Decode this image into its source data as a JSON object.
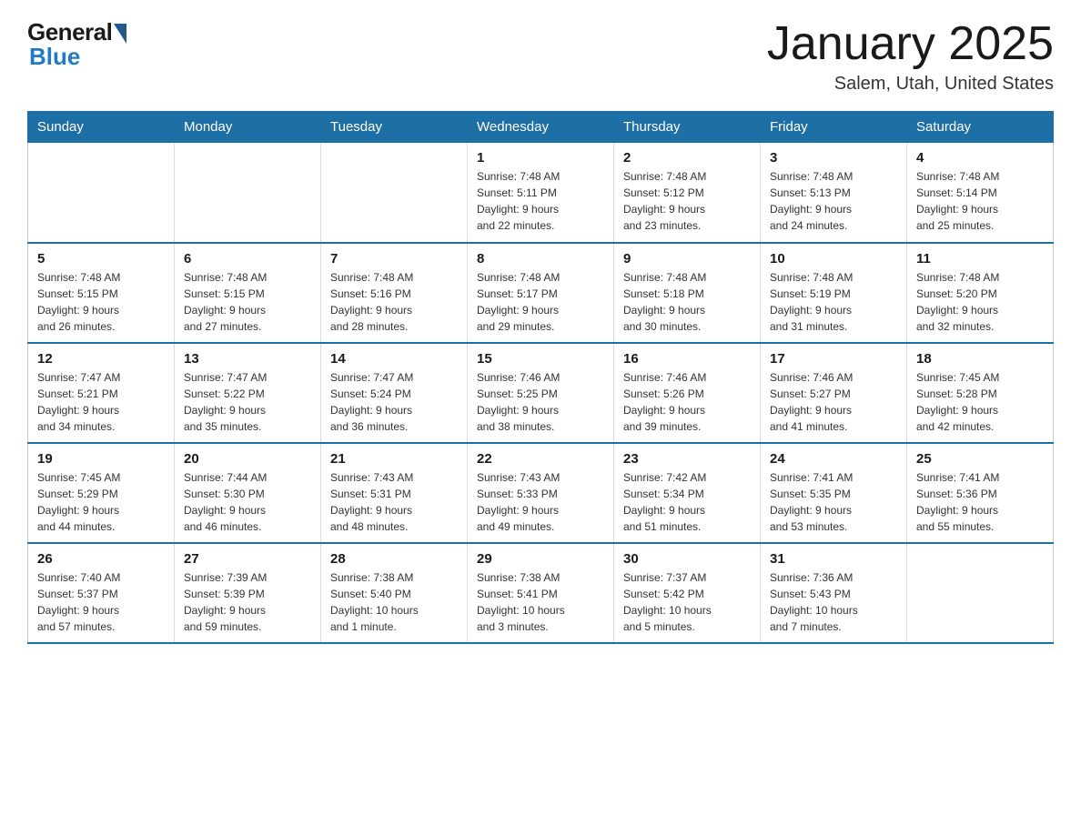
{
  "logo": {
    "text_general": "General",
    "text_blue": "Blue"
  },
  "header": {
    "month": "January 2025",
    "location": "Salem, Utah, United States"
  },
  "weekdays": [
    "Sunday",
    "Monday",
    "Tuesday",
    "Wednesday",
    "Thursday",
    "Friday",
    "Saturday"
  ],
  "weeks": [
    [
      {
        "day": "",
        "info": ""
      },
      {
        "day": "",
        "info": ""
      },
      {
        "day": "",
        "info": ""
      },
      {
        "day": "1",
        "info": "Sunrise: 7:48 AM\nSunset: 5:11 PM\nDaylight: 9 hours\nand 22 minutes."
      },
      {
        "day": "2",
        "info": "Sunrise: 7:48 AM\nSunset: 5:12 PM\nDaylight: 9 hours\nand 23 minutes."
      },
      {
        "day": "3",
        "info": "Sunrise: 7:48 AM\nSunset: 5:13 PM\nDaylight: 9 hours\nand 24 minutes."
      },
      {
        "day": "4",
        "info": "Sunrise: 7:48 AM\nSunset: 5:14 PM\nDaylight: 9 hours\nand 25 minutes."
      }
    ],
    [
      {
        "day": "5",
        "info": "Sunrise: 7:48 AM\nSunset: 5:15 PM\nDaylight: 9 hours\nand 26 minutes."
      },
      {
        "day": "6",
        "info": "Sunrise: 7:48 AM\nSunset: 5:15 PM\nDaylight: 9 hours\nand 27 minutes."
      },
      {
        "day": "7",
        "info": "Sunrise: 7:48 AM\nSunset: 5:16 PM\nDaylight: 9 hours\nand 28 minutes."
      },
      {
        "day": "8",
        "info": "Sunrise: 7:48 AM\nSunset: 5:17 PM\nDaylight: 9 hours\nand 29 minutes."
      },
      {
        "day": "9",
        "info": "Sunrise: 7:48 AM\nSunset: 5:18 PM\nDaylight: 9 hours\nand 30 minutes."
      },
      {
        "day": "10",
        "info": "Sunrise: 7:48 AM\nSunset: 5:19 PM\nDaylight: 9 hours\nand 31 minutes."
      },
      {
        "day": "11",
        "info": "Sunrise: 7:48 AM\nSunset: 5:20 PM\nDaylight: 9 hours\nand 32 minutes."
      }
    ],
    [
      {
        "day": "12",
        "info": "Sunrise: 7:47 AM\nSunset: 5:21 PM\nDaylight: 9 hours\nand 34 minutes."
      },
      {
        "day": "13",
        "info": "Sunrise: 7:47 AM\nSunset: 5:22 PM\nDaylight: 9 hours\nand 35 minutes."
      },
      {
        "day": "14",
        "info": "Sunrise: 7:47 AM\nSunset: 5:24 PM\nDaylight: 9 hours\nand 36 minutes."
      },
      {
        "day": "15",
        "info": "Sunrise: 7:46 AM\nSunset: 5:25 PM\nDaylight: 9 hours\nand 38 minutes."
      },
      {
        "day": "16",
        "info": "Sunrise: 7:46 AM\nSunset: 5:26 PM\nDaylight: 9 hours\nand 39 minutes."
      },
      {
        "day": "17",
        "info": "Sunrise: 7:46 AM\nSunset: 5:27 PM\nDaylight: 9 hours\nand 41 minutes."
      },
      {
        "day": "18",
        "info": "Sunrise: 7:45 AM\nSunset: 5:28 PM\nDaylight: 9 hours\nand 42 minutes."
      }
    ],
    [
      {
        "day": "19",
        "info": "Sunrise: 7:45 AM\nSunset: 5:29 PM\nDaylight: 9 hours\nand 44 minutes."
      },
      {
        "day": "20",
        "info": "Sunrise: 7:44 AM\nSunset: 5:30 PM\nDaylight: 9 hours\nand 46 minutes."
      },
      {
        "day": "21",
        "info": "Sunrise: 7:43 AM\nSunset: 5:31 PM\nDaylight: 9 hours\nand 48 minutes."
      },
      {
        "day": "22",
        "info": "Sunrise: 7:43 AM\nSunset: 5:33 PM\nDaylight: 9 hours\nand 49 minutes."
      },
      {
        "day": "23",
        "info": "Sunrise: 7:42 AM\nSunset: 5:34 PM\nDaylight: 9 hours\nand 51 minutes."
      },
      {
        "day": "24",
        "info": "Sunrise: 7:41 AM\nSunset: 5:35 PM\nDaylight: 9 hours\nand 53 minutes."
      },
      {
        "day": "25",
        "info": "Sunrise: 7:41 AM\nSunset: 5:36 PM\nDaylight: 9 hours\nand 55 minutes."
      }
    ],
    [
      {
        "day": "26",
        "info": "Sunrise: 7:40 AM\nSunset: 5:37 PM\nDaylight: 9 hours\nand 57 minutes."
      },
      {
        "day": "27",
        "info": "Sunrise: 7:39 AM\nSunset: 5:39 PM\nDaylight: 9 hours\nand 59 minutes."
      },
      {
        "day": "28",
        "info": "Sunrise: 7:38 AM\nSunset: 5:40 PM\nDaylight: 10 hours\nand 1 minute."
      },
      {
        "day": "29",
        "info": "Sunrise: 7:38 AM\nSunset: 5:41 PM\nDaylight: 10 hours\nand 3 minutes."
      },
      {
        "day": "30",
        "info": "Sunrise: 7:37 AM\nSunset: 5:42 PM\nDaylight: 10 hours\nand 5 minutes."
      },
      {
        "day": "31",
        "info": "Sunrise: 7:36 AM\nSunset: 5:43 PM\nDaylight: 10 hours\nand 7 minutes."
      },
      {
        "day": "",
        "info": ""
      }
    ]
  ]
}
